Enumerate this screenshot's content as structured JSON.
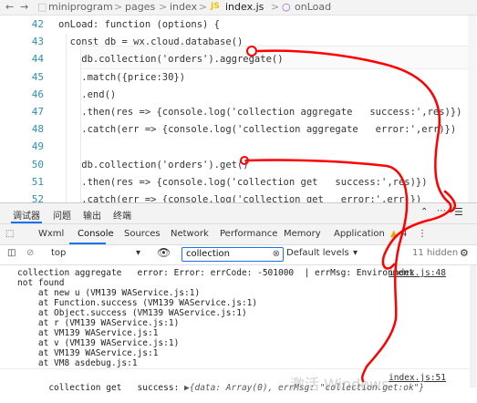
{
  "breadcrumb": {
    "items": [
      "miniprogram",
      "pages",
      "index",
      "index.js",
      "onLoad"
    ],
    "separator": ">"
  },
  "editor": {
    "lines": [
      {
        "no": "42",
        "text": "onLoad: function (options) {"
      },
      {
        "no": "43",
        "text": "  const db = wx.cloud.database()"
      },
      {
        "no": "44",
        "text": "    db.collection('orders').aggregate()"
      },
      {
        "no": "45",
        "text": "    .match({price:30})"
      },
      {
        "no": "46",
        "text": "    .end()"
      },
      {
        "no": "47",
        "text": "    .then(res => {console.log('collection aggregate   success:',res)})"
      },
      {
        "no": "48",
        "text": "    .catch(err => {console.log('collection aggregate   error:',err)})"
      },
      {
        "no": "49",
        "text": ""
      },
      {
        "no": "50",
        "text": "    db.collection('orders').get()"
      },
      {
        "no": "51",
        "text": "    .then(res => {console.log('collection get   success:',res)})"
      },
      {
        "no": "52",
        "text": "    .catch(err => {console.log('collection get   error:',err)})"
      }
    ]
  },
  "devtools": {
    "top_tabs": [
      "调试器",
      "问题",
      "输出",
      "终端"
    ],
    "tabs": [
      "Wxml",
      "Console",
      "Sources",
      "Network",
      "Performance",
      "Memory",
      "Application"
    ],
    "warning_count": "4",
    "toolbar": {
      "context": "top",
      "filter_value": "collection",
      "levels": "Default levels",
      "hidden": "11 hidden"
    },
    "console": {
      "error_lines": [
        "collection aggregate   error: Error: errCode: -501000  | errMsg: Environment",
        "not found",
        "    at new u (VM139 WAService.js:1)",
        "    at Function.success (VM139 WAService.js:1)",
        "    at Object.success (VM139 WAService.js:1)",
        "    at r (VM139 WAService.js:1)",
        "    at VM139 WAService.js:1",
        "    at v (VM139 WAService.js:1)",
        "    at VM139 WAService.js:1",
        "    at VM8 asdebug.js:1"
      ],
      "error_source": "index.js:48",
      "success_prefix": "collection get   success: ",
      "success_value": "▶{data: Array(0), errMsg: \"collection.get:ok\"}",
      "success_source": "index.js:51"
    }
  },
  "watermark": "激活 Windows",
  "colors": {
    "annotation": "#ff0000",
    "accent": "#1a73e8",
    "line_number": "#2b91af"
  }
}
